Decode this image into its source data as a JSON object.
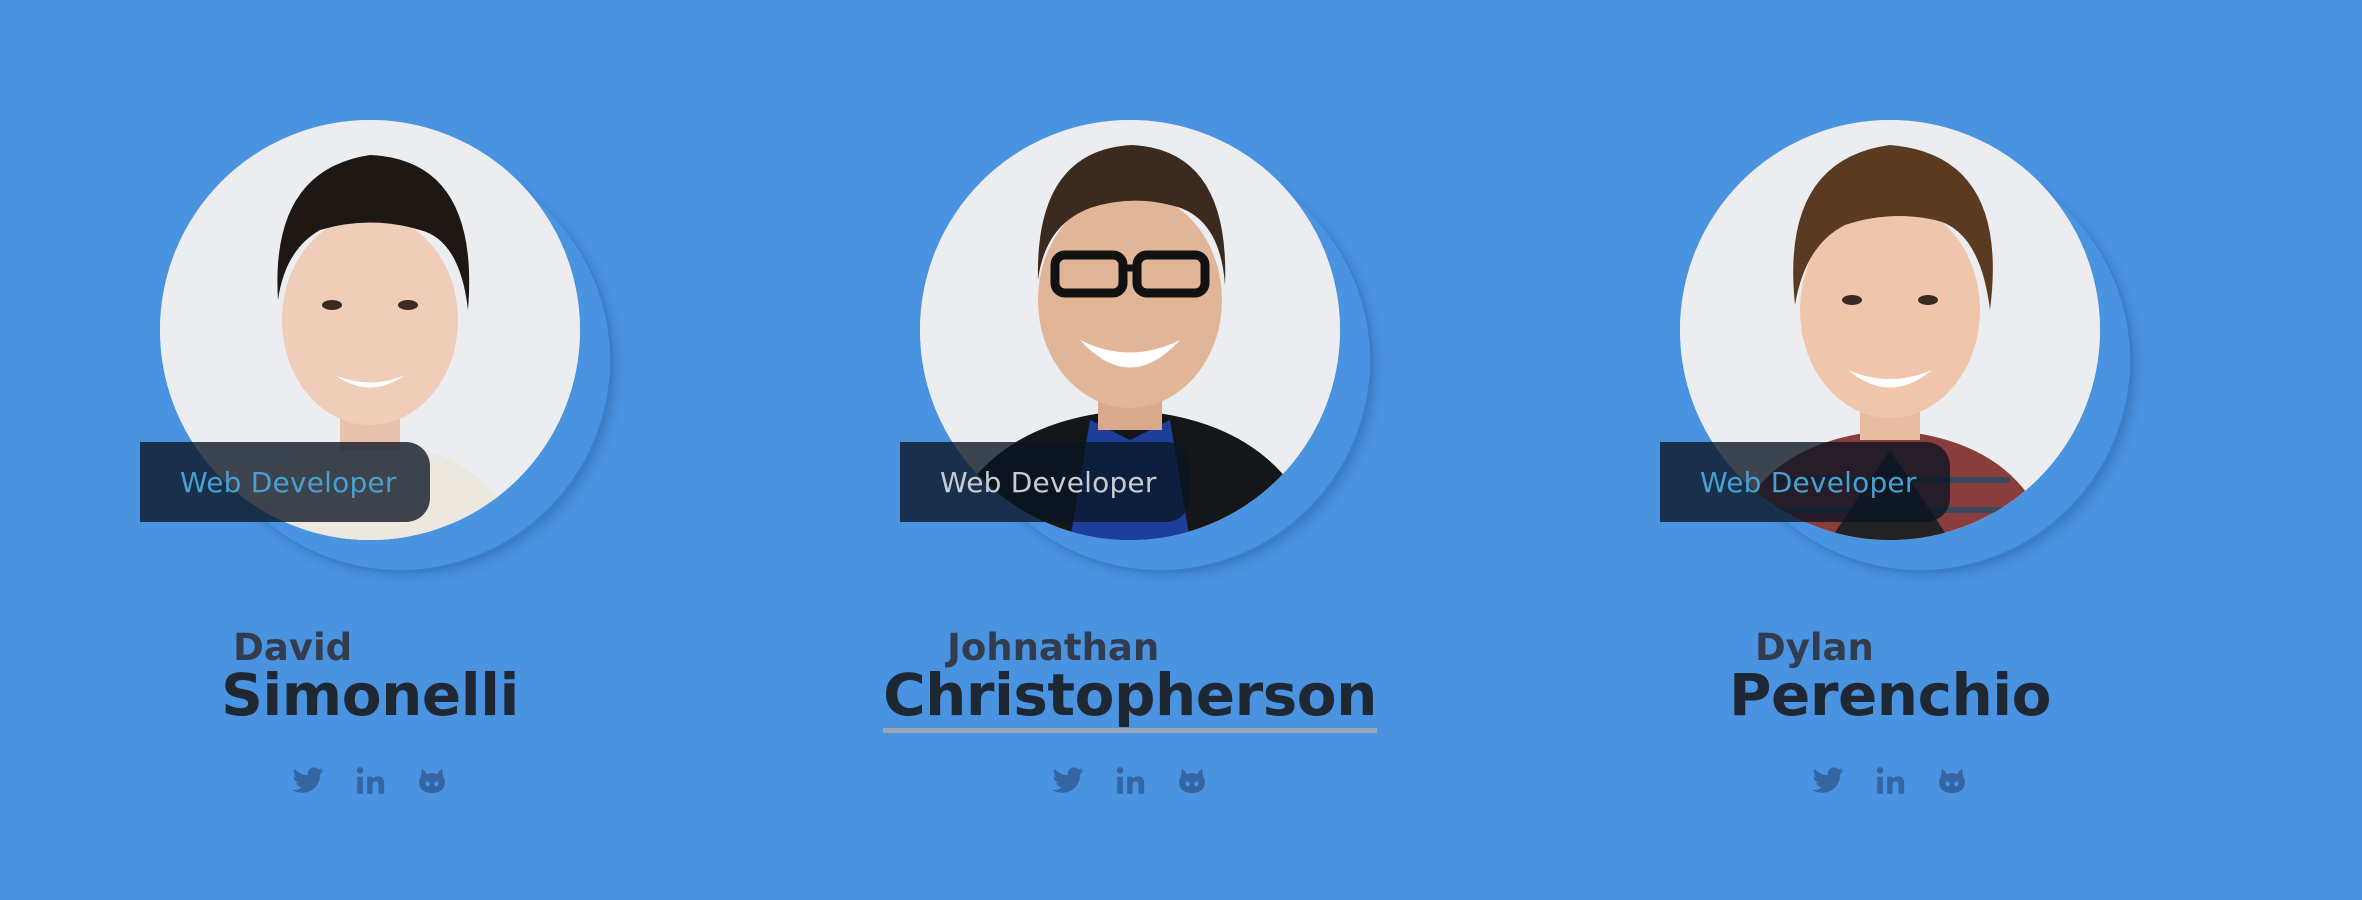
{
  "team": [
    {
      "first_name": "David",
      "last_name": "Simonelli",
      "role": "Web Developer",
      "photo": "portrait-david",
      "hair_color": "#1f1714",
      "shirt_color": "#ece7df"
    },
    {
      "first_name": "Johnathan",
      "last_name": "Christopherson",
      "role": "Web Developer",
      "photo": "portrait-johnathan",
      "hair_color": "#3b2a1e",
      "shirt_color": "#1d3f9a"
    },
    {
      "first_name": "Dylan",
      "last_name": "Perenchio",
      "role": "Web Developer",
      "photo": "portrait-dylan",
      "hair_color": "#5a3b22",
      "shirt_color": "#8a3d3d"
    }
  ],
  "social_icons": [
    "twitter-icon",
    "linkedin-icon",
    "github-icon"
  ],
  "colors": {
    "background": "#4a93e0",
    "icon": "#3565a3",
    "badge_text_accent": "#4a9fd2",
    "badge_text_light": "#c9ccd2",
    "name_dark": "#1f2733"
  }
}
